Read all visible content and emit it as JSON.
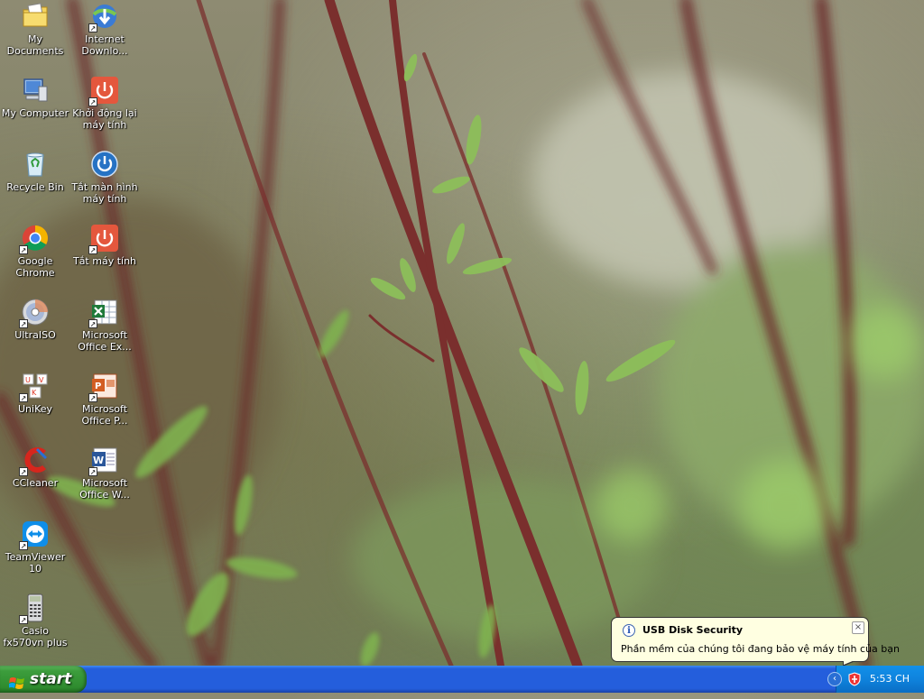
{
  "desktop": {
    "icons": [
      {
        "label": "My Documents",
        "icon": "folder-documents-icon"
      },
      {
        "label": "My Computer",
        "icon": "computer-icon"
      },
      {
        "label": "Recycle Bin",
        "icon": "recycle-bin-icon"
      },
      {
        "label": "Google Chrome",
        "icon": "chrome-icon"
      },
      {
        "label": "UltraISO",
        "icon": "disc-icon"
      },
      {
        "label": "UniKey",
        "icon": "unikey-icon"
      },
      {
        "label": "CCleaner",
        "icon": "ccleaner-icon"
      },
      {
        "label": "TeamViewer 10",
        "icon": "teamviewer-icon"
      },
      {
        "label": "Casio fx570vn plus",
        "icon": "calculator-icon"
      },
      {
        "label": "Internet Downlo...",
        "icon": "internet-download-manager-icon"
      },
      {
        "label": "Khởi động lại máy tính",
        "icon": "restart-icon"
      },
      {
        "label": "Tắt màn hình máy tính",
        "icon": "monitor-off-icon"
      },
      {
        "label": "Tắt máy tính",
        "icon": "shutdown-icon"
      },
      {
        "label": "Microsoft Office Ex...",
        "icon": "excel-icon"
      },
      {
        "label": "Microsoft Office P...",
        "icon": "powerpoint-icon"
      },
      {
        "label": "Microsoft Office W...",
        "icon": "word-icon"
      }
    ]
  },
  "taskbar": {
    "start_label": "start",
    "clock": "5:53 CH",
    "expand_glyph": "‹"
  },
  "balloon": {
    "title": "USB Disk Security",
    "text": "Phần mềm của chúng tôi đang bảo vệ máy tính của bạn",
    "info_glyph": "i",
    "close_glyph": "×"
  },
  "colors": {
    "taskbar_blue": "#245edc",
    "start_green": "#3c9d3c",
    "tray_blue": "#0f83dd",
    "balloon_bg": "#ffffe1"
  }
}
